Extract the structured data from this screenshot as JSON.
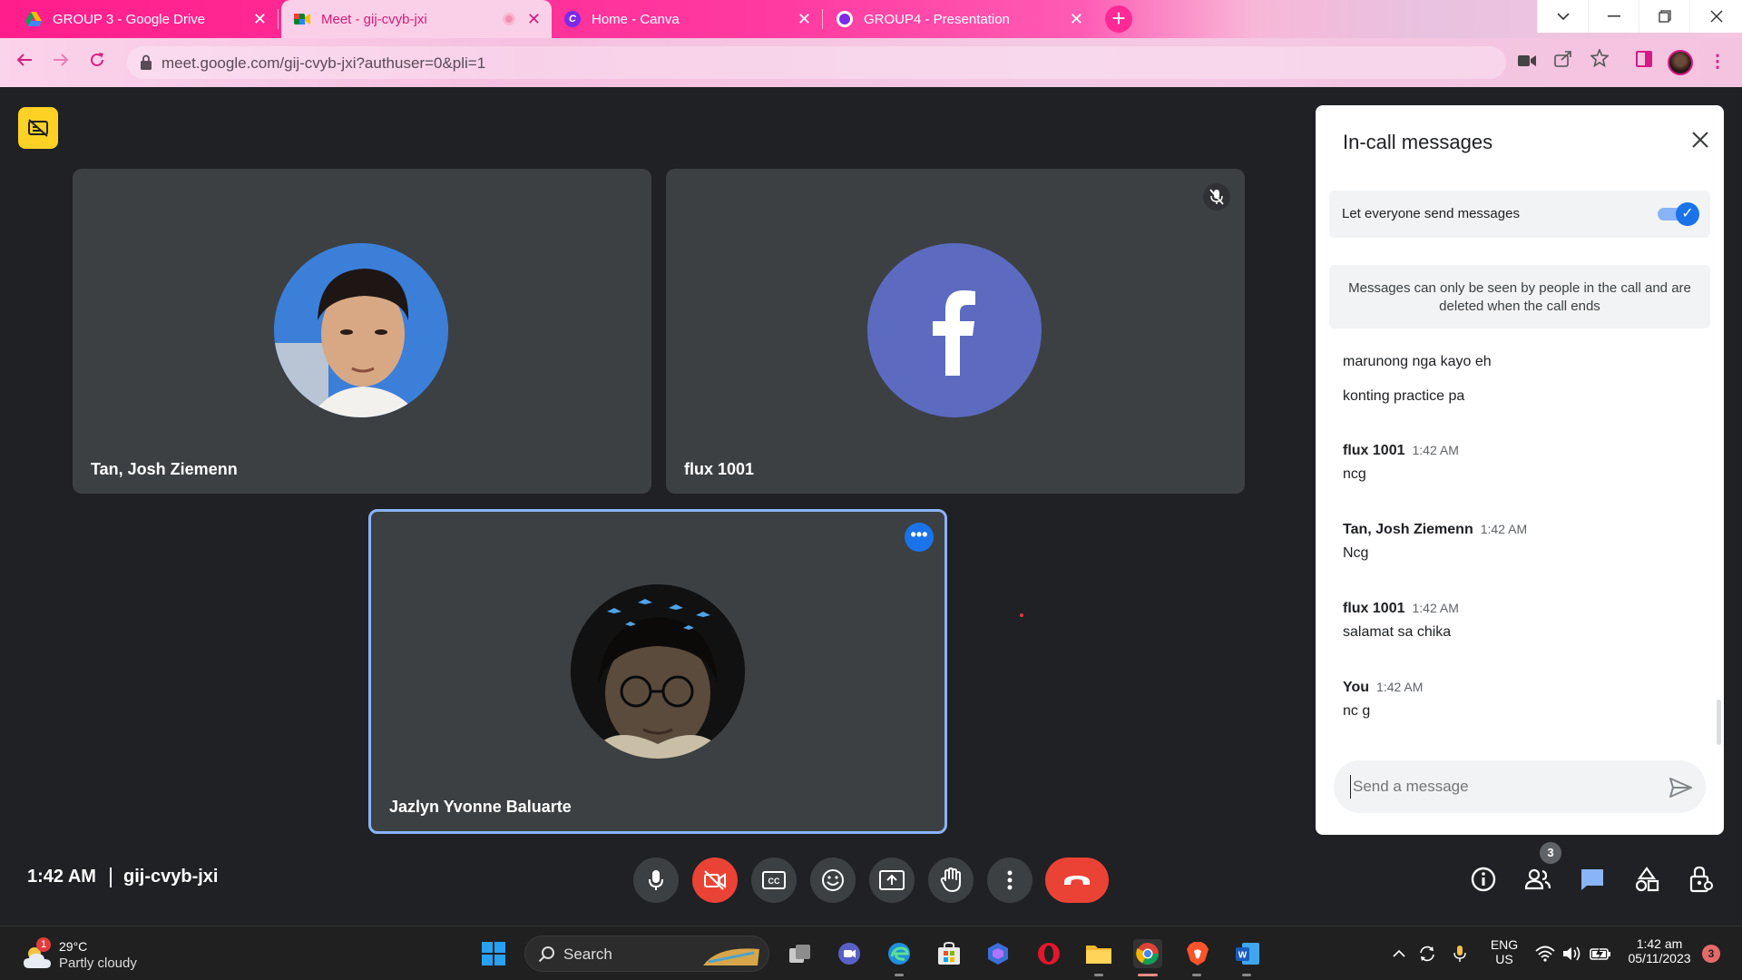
{
  "browser": {
    "tabs": [
      {
        "title": "GROUP 3 - Google Drive",
        "active": false
      },
      {
        "title": "Meet - gij-cvyb-jxi",
        "active": true
      },
      {
        "title": "Home - Canva",
        "active": false
      },
      {
        "title": "GROUP4 - Presentation",
        "active": false
      }
    ],
    "url": "meet.google.com/gij-cvyb-jxi?authuser=0&pli=1",
    "accent_color": "#ff1e8c"
  },
  "meet": {
    "participants": [
      {
        "name": "Tan, Josh Ziemenn",
        "avatar": "photo"
      },
      {
        "name": "flux 1001",
        "avatar": "facebook-letter-f",
        "avatar_color": "#5c6bc0",
        "muted": true
      },
      {
        "name": "Jazlyn Yvonne Baluarte",
        "avatar": "photo",
        "active_speaker": true
      }
    ],
    "time": "1:42 AM",
    "meeting_code": "gij-cvyb-jxi",
    "people_count": "3",
    "hangup_color": "#ea4335"
  },
  "chat": {
    "title": "In-call messages",
    "toggle_label": "Let everyone send messages",
    "toggle_on": true,
    "notice": "Messages can only be seen by people in the call and are deleted when the call ends",
    "messages": [
      {
        "sender": "",
        "time": "",
        "text": "marunong nga kayo eh"
      },
      {
        "sender": "",
        "time": "",
        "text": "konting practice pa"
      },
      {
        "sender": "flux 1001",
        "time": "1:42 AM",
        "text": "ncg"
      },
      {
        "sender": "Tan, Josh Ziemenn",
        "time": "1:42 AM",
        "text": "Ncg"
      },
      {
        "sender": "flux 1001",
        "time": "1:42 AM",
        "text": "salamat sa chika"
      },
      {
        "sender": "You",
        "time": "1:42 AM",
        "text": "nc g"
      }
    ],
    "input_placeholder": "Send a message"
  },
  "taskbar": {
    "weather_temp": "29°C",
    "weather_condition": "Partly cloudy",
    "weather_badge": "1",
    "search_label": "Search",
    "lang_top": "ENG",
    "lang_bottom": "US",
    "clock_time": "1:42 am",
    "clock_date": "05/11/2023",
    "notification_count": "3"
  }
}
